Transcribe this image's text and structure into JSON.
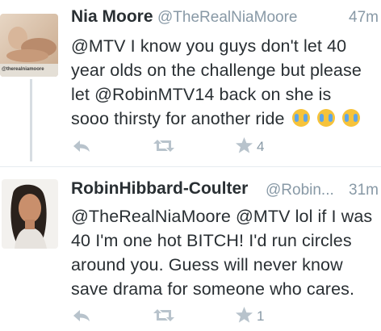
{
  "tweets": [
    {
      "name": "Nia Moore",
      "handle": "@TheRealNiaMoore",
      "time": "47m",
      "avatar_watermark": "@therealniamoore",
      "lines": [
        "@MTV I know you guys don't let 40",
        "year olds on the challenge but please",
        "let @RobinMTV14 back on she is",
        "sooo thirsty for another ride"
      ],
      "emoji": [
        "crying-face",
        "crying-face",
        "crying-face"
      ],
      "favorite_count": "4"
    },
    {
      "name": "RobinHibbard-Coulter",
      "handle": "@Robin...",
      "time": "31m",
      "lines": [
        "@TheRealNiaMoore @MTV lol if I was",
        "40 I'm one hot BITCH! I'd run circles",
        "around you. Guess will never know",
        "save drama for someone who cares."
      ],
      "favorite_count": "1"
    }
  ],
  "colors": {
    "name": "#292f33",
    "meta": "#8899a6",
    "action_icon": "#b8c3cc",
    "divider": "#e6ecf0"
  }
}
